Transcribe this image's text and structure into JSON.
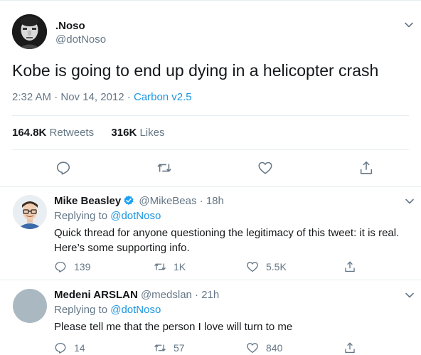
{
  "main_tweet": {
    "display_name": ".Noso",
    "handle": "@dotNoso",
    "text": "Kobe is going to end up dying in a helicopter crash",
    "timestamp": "2:32 AM · Nov 14, 2012 · ",
    "source": "Carbon v2.5",
    "retweets_count": "164.8K",
    "retweets_label": "Retweets",
    "likes_count": "316K",
    "likes_label": "Likes"
  },
  "replies": [
    {
      "display_name": "Mike Beasley",
      "verified": true,
      "handle_time": "@MikeBeas · 18h",
      "replying_prefix": "Replying to ",
      "replying_to": "@dotNoso",
      "text": "Quick thread for anyone questioning the legitimacy of this tweet: it is real. Here’s some supporting info.",
      "replies_count": "139",
      "retweets_count": "1K",
      "likes_count": "5.5K"
    },
    {
      "display_name": "Medeni ARSLAN",
      "verified": false,
      "handle_time": "@medslan · 21h",
      "replying_prefix": "Replying to ",
      "replying_to": "@dotNoso",
      "text": "Please tell me that the person I love will turn to me",
      "replies_count": "14",
      "retweets_count": "57",
      "likes_count": "840"
    }
  ],
  "icons": [
    "chevron-down-icon",
    "reply-icon",
    "retweet-icon",
    "like-icon",
    "share-icon",
    "verified-icon"
  ],
  "colors": {
    "link": "#1b95e0",
    "muted": "#657786",
    "text": "#14171a",
    "divider": "#e6ecf0"
  }
}
